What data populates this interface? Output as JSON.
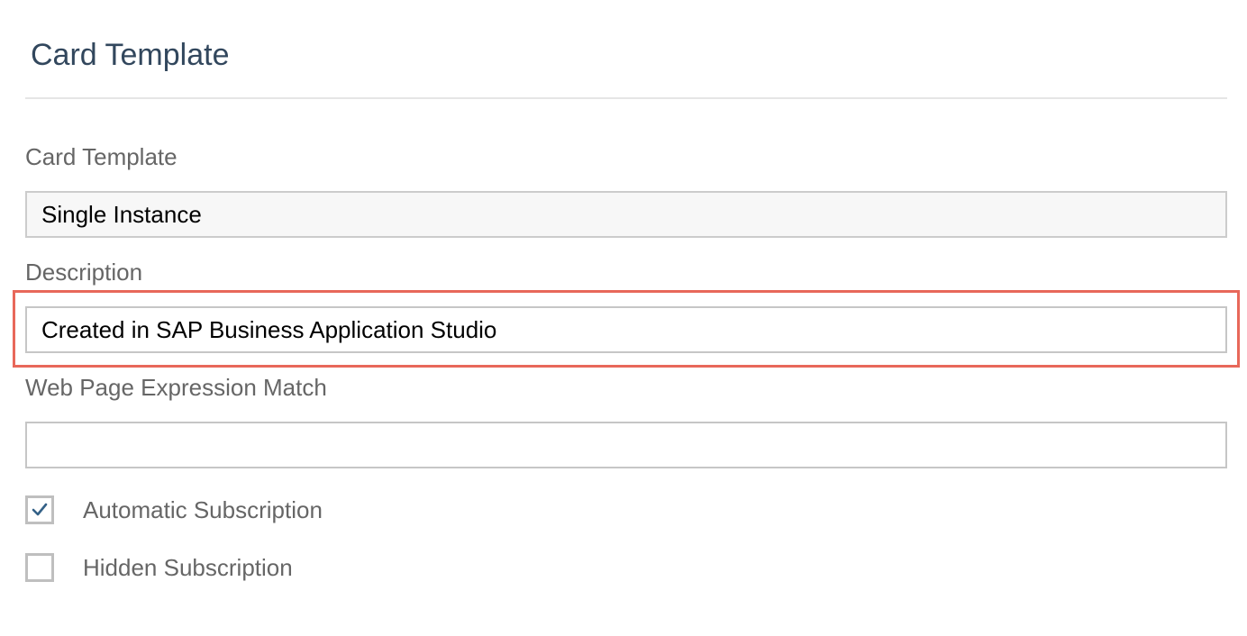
{
  "header": {
    "title": "Card Template"
  },
  "form": {
    "card_template": {
      "label": "Card Template",
      "value": "Single Instance"
    },
    "description": {
      "label": "Description",
      "value": "Created in SAP Business Application Studio"
    },
    "web_page_expression_match": {
      "label": "Web Page Expression Match",
      "value": ""
    },
    "automatic_subscription": {
      "label": "Automatic Subscription",
      "checked": true
    },
    "hidden_subscription": {
      "label": "Hidden Subscription",
      "checked": false
    }
  },
  "colors": {
    "title": "#32475d",
    "label": "#666666",
    "highlight": "#e8685a",
    "checkmark": "#346187"
  },
  "icons": {
    "checkmark": "check-icon"
  }
}
